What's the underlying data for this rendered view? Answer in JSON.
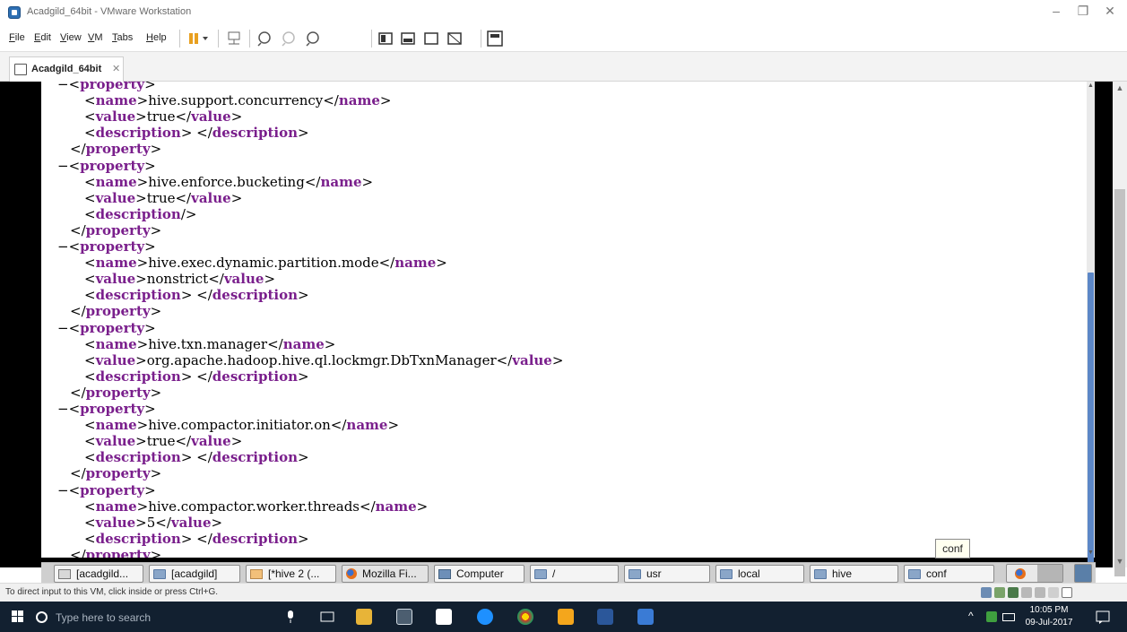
{
  "window": {
    "title": "Acadgild_64bit - VMware Workstation",
    "controls": [
      "–",
      "❐",
      "✕"
    ]
  },
  "menu": [
    {
      "accel": "F",
      "rest": "ile"
    },
    {
      "accel": "E",
      "rest": "dit"
    },
    {
      "accel": "V",
      "rest": "iew"
    },
    {
      "accel": "V",
      "rest": "M"
    },
    {
      "accel": "T",
      "rest": "abs"
    },
    {
      "accel": "H",
      "rest": "elp"
    }
  ],
  "tab": {
    "label": "Acadgild_64bit",
    "close": "✕"
  },
  "xml": {
    "minus": "−",
    "lines": [
      {
        "indent": 0,
        "pre": "−<",
        "tag": "property",
        "mid": ">",
        "tag2": "",
        "post": ""
      },
      {
        "indent": 1,
        "pre": "<",
        "tag": "name",
        "mid": ">hive.support.concurrency</",
        "tag2": "name",
        "post": ">"
      },
      {
        "indent": 1,
        "pre": "<",
        "tag": "value",
        "mid": ">true</",
        "tag2": "value",
        "post": ">"
      },
      {
        "indent": 1,
        "pre": "<",
        "tag": "description",
        "mid": "> </",
        "tag2": "description",
        "post": ">"
      },
      {
        "indent": 0.5,
        "pre": "</",
        "tag": "property",
        "mid": ">",
        "tag2": "",
        "post": ""
      },
      {
        "indent": 0,
        "pre": "−<",
        "tag": "property",
        "mid": ">",
        "tag2": "",
        "post": ""
      },
      {
        "indent": 1,
        "pre": "<",
        "tag": "name",
        "mid": ">hive.enforce.bucketing</",
        "tag2": "name",
        "post": ">"
      },
      {
        "indent": 1,
        "pre": "<",
        "tag": "value",
        "mid": ">true</",
        "tag2": "value",
        "post": ">"
      },
      {
        "indent": 1,
        "pre": "<",
        "tag": "description",
        "mid": "/>",
        "tag2": "",
        "post": ""
      },
      {
        "indent": 0.5,
        "pre": "</",
        "tag": "property",
        "mid": ">",
        "tag2": "",
        "post": ""
      },
      {
        "indent": 0,
        "pre": "−<",
        "tag": "property",
        "mid": ">",
        "tag2": "",
        "post": ""
      },
      {
        "indent": 1,
        "pre": "<",
        "tag": "name",
        "mid": ">hive.exec.dynamic.partition.mode</",
        "tag2": "name",
        "post": ">"
      },
      {
        "indent": 1,
        "pre": "<",
        "tag": "value",
        "mid": ">nonstrict</",
        "tag2": "value",
        "post": ">"
      },
      {
        "indent": 1,
        "pre": "<",
        "tag": "description",
        "mid": "> </",
        "tag2": "description",
        "post": ">"
      },
      {
        "indent": 0.5,
        "pre": "</",
        "tag": "property",
        "mid": ">",
        "tag2": "",
        "post": ""
      },
      {
        "indent": 0,
        "pre": "−<",
        "tag": "property",
        "mid": ">",
        "tag2": "",
        "post": ""
      },
      {
        "indent": 1,
        "pre": "<",
        "tag": "name",
        "mid": ">hive.txn.manager</",
        "tag2": "name",
        "post": ">"
      },
      {
        "indent": 1,
        "pre": "<",
        "tag": "value",
        "mid": ">org.apache.hadoop.hive.ql.lockmgr.DbTxnManager</",
        "tag2": "value",
        "post": ">"
      },
      {
        "indent": 1,
        "pre": "<",
        "tag": "description",
        "mid": "> </",
        "tag2": "description",
        "post": ">"
      },
      {
        "indent": 0.5,
        "pre": "</",
        "tag": "property",
        "mid": ">",
        "tag2": "",
        "post": ""
      },
      {
        "indent": 0,
        "pre": "−<",
        "tag": "property",
        "mid": ">",
        "tag2": "",
        "post": ""
      },
      {
        "indent": 1,
        "pre": "<",
        "tag": "name",
        "mid": ">hive.compactor.initiator.on</",
        "tag2": "name",
        "post": ">"
      },
      {
        "indent": 1,
        "pre": "<",
        "tag": "value",
        "mid": ">true</",
        "tag2": "value",
        "post": ">"
      },
      {
        "indent": 1,
        "pre": "<",
        "tag": "description",
        "mid": "> </",
        "tag2": "description",
        "post": ">"
      },
      {
        "indent": 0.5,
        "pre": "</",
        "tag": "property",
        "mid": ">",
        "tag2": "",
        "post": ""
      },
      {
        "indent": 0,
        "pre": "−<",
        "tag": "property",
        "mid": ">",
        "tag2": "",
        "post": ""
      },
      {
        "indent": 1,
        "pre": "<",
        "tag": "name",
        "mid": ">hive.compactor.worker.threads</",
        "tag2": "name",
        "post": ">"
      },
      {
        "indent": 1,
        "pre": "<",
        "tag": "value",
        "mid": ">5</",
        "tag2": "value",
        "post": ">"
      },
      {
        "indent": 1,
        "pre": "<",
        "tag": "description",
        "mid": "> </",
        "tag2": "description",
        "post": ">"
      },
      {
        "indent": 0.5,
        "pre": "</",
        "tag": "property",
        "mid": ">",
        "tag2": "",
        "post": ""
      }
    ]
  },
  "tooltip": "conf",
  "guest_taskbar": [
    {
      "label": "[acadgild...",
      "icon": "term"
    },
    {
      "label": "[acadgild]",
      "icon": "folder"
    },
    {
      "label": "[*hive 2 (...",
      "icon": "editor"
    },
    {
      "label": "Mozilla Fi...",
      "icon": "ff",
      "active": true
    },
    {
      "label": "Computer",
      "icon": "comp"
    },
    {
      "label": "/",
      "icon": "folder"
    },
    {
      "label": "usr",
      "icon": "folder"
    },
    {
      "label": "local",
      "icon": "folder"
    },
    {
      "label": "hive",
      "icon": "folder"
    },
    {
      "label": "conf",
      "icon": "folder"
    }
  ],
  "status": "To direct input to this VM, click inside or press Ctrl+G.",
  "win_taskbar": {
    "search_placeholder": "Type here to search",
    "time": "10:05 PM",
    "date": "09-Jul-2017",
    "tray_chevron": "^"
  },
  "colors": {
    "xml_tag": "#7a1f8c",
    "vm_bg": "#000000",
    "taskbar": "#122030",
    "scroll_thumb": "#5c87c7"
  }
}
